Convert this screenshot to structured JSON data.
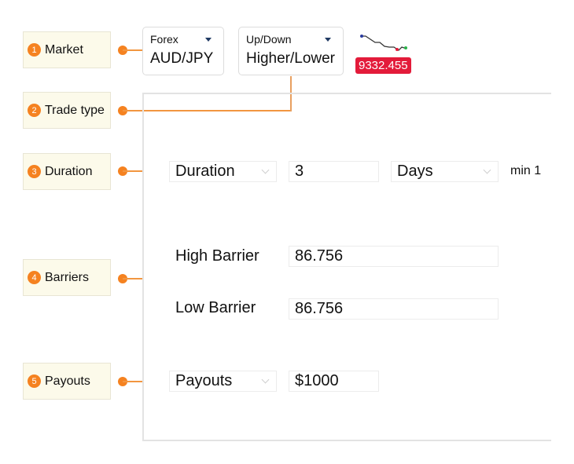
{
  "annotations": [
    {
      "number": "1",
      "label": "Market"
    },
    {
      "number": "2",
      "label": "Trade type"
    },
    {
      "number": "3",
      "label": "Duration"
    },
    {
      "number": "4",
      "label": "Barriers"
    },
    {
      "number": "5",
      "label": "Payouts"
    }
  ],
  "market_selector": {
    "category": "Forex",
    "value": "AUD/JPY"
  },
  "trade_type_selector": {
    "category": "Up/Down",
    "value": "Higher/Lower"
  },
  "ticker": {
    "price": "9332.455",
    "price_color": "#e31b3a"
  },
  "form": {
    "duration": {
      "select": "Duration",
      "amount": "3",
      "unit": "Days",
      "hint": "min 1"
    },
    "high_barrier": {
      "label": "High Barrier",
      "value": "86.756"
    },
    "low_barrier": {
      "label": "Low Barrier",
      "value": "86.756"
    },
    "payout": {
      "select": "Payouts",
      "amount": "$1000"
    }
  },
  "colors": {
    "accent": "#f58220",
    "label_bg": "#fcfaea"
  }
}
